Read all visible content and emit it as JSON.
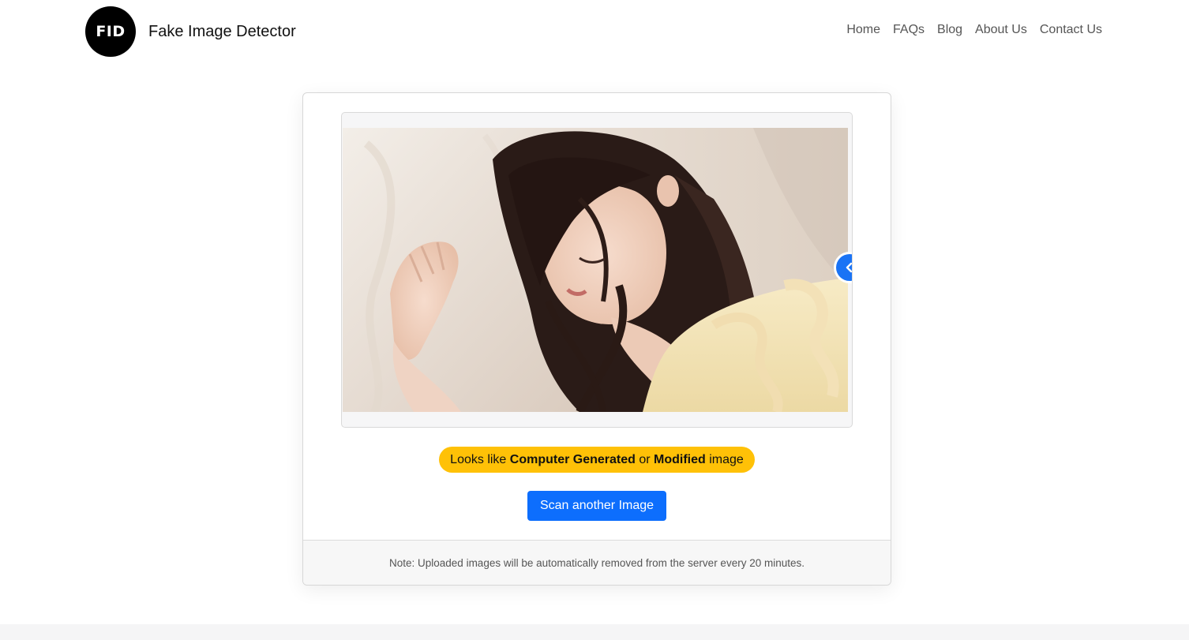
{
  "header": {
    "logo_text": "FID",
    "brand_name": "Fake Image Detector",
    "nav": [
      "Home",
      "FAQs",
      "Blog",
      "About Us",
      "Contact Us"
    ]
  },
  "result": {
    "image_alt": "Uploaded photo: woman sleeping on a pillow",
    "verdict": {
      "prefix": "Looks like ",
      "strong1": "Computer Generated",
      "middle": " or ",
      "strong2": "Modified",
      "suffix": " image"
    },
    "scan_button": "Scan another Image",
    "note": "Note: Uploaded images will be automatically removed from the server every 20 minutes."
  },
  "icons": {
    "compare_handle": "chevron-left-icon",
    "logo": "fid-logo"
  },
  "colors": {
    "verdict_bg": "#ffc107",
    "primary": "#0d6efd",
    "handle": "#1a73f5"
  }
}
